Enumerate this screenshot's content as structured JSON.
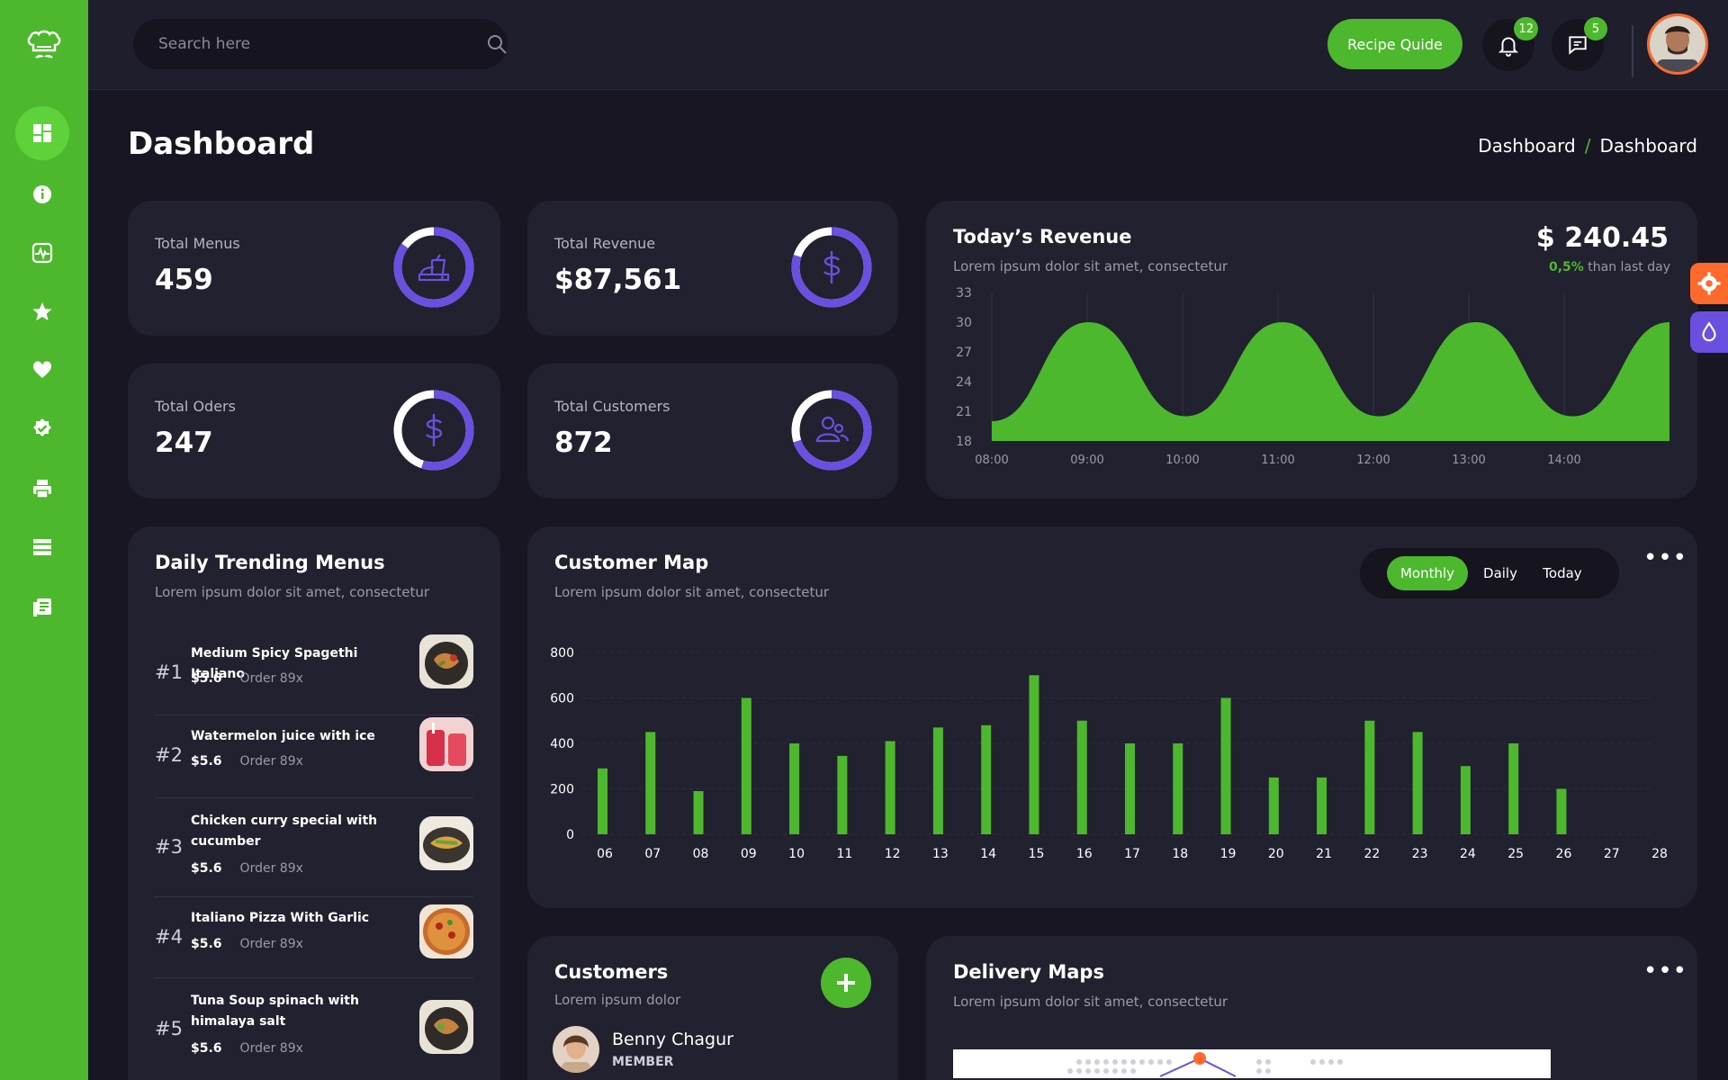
{
  "header": {
    "search_placeholder": "Search here",
    "recipe_button": "Recipe Quide",
    "notifications_count": "12",
    "messages_count": "5"
  },
  "page": {
    "title": "Dashboard",
    "breadcrumb": [
      "Dashboard",
      "/",
      "Dashboard"
    ]
  },
  "stats": [
    {
      "label": "Total Menus",
      "value": "459",
      "icon": "fast-food-icon",
      "progress": 0.85
    },
    {
      "label": "Total Revenue",
      "value": "$87,561",
      "icon": "dollar-icon",
      "progress": 0.8
    },
    {
      "label": "Total Oders",
      "value": "247",
      "icon": "dollar-icon",
      "progress": 0.55
    },
    {
      "label": "Total Customers",
      "value": "872",
      "icon": "customers-icon",
      "progress": 0.7
    }
  ],
  "revenue": {
    "title": "Today’s Revenue",
    "subtitle": "Lorem ipsum dolor sit amet, consectetur",
    "amount": "$ 240.45",
    "change_pct": "0,5%",
    "change_text": "than last day"
  },
  "trending": {
    "title": "Daily Trending Menus",
    "subtitle": "Lorem ipsum dolor sit amet, consectetur",
    "items": [
      {
        "rank": "#1",
        "name": "Medium Spicy Spagethi Italiano",
        "price": "$5.6",
        "order": "Order 89x"
      },
      {
        "rank": "#2",
        "name": "Watermelon juice with ice",
        "price": "$5.6",
        "order": "Order 89x"
      },
      {
        "rank": "#3",
        "name": "Chicken curry special with cucumber",
        "price": "$5.6",
        "order": "Order 89x"
      },
      {
        "rank": "#4",
        "name": "Italiano Pizza With Garlic",
        "price": "$5.6",
        "order": "Order 89x"
      },
      {
        "rank": "#5",
        "name": "Tuna Soup spinach with himalaya salt",
        "price": "$5.6",
        "order": "Order 89x"
      }
    ]
  },
  "customer_map": {
    "title": "Customer Map",
    "subtitle": "Lorem ipsum dolor sit amet, consectetur",
    "tabs": [
      "Monthly",
      "Daily",
      "Today"
    ],
    "active_tab": "Monthly"
  },
  "customers": {
    "title": "Customers",
    "subtitle": "Lorem ipsum dolor",
    "person_name": "Benny Chagur",
    "person_role": "MEMBER"
  },
  "delivery": {
    "title": "Delivery Maps",
    "subtitle": "Lorem ipsum dolor sit amet, consectetur"
  },
  "colors": {
    "accent": "#4db82d",
    "ring": "#6a4fe0",
    "orange": "#ff6a2c",
    "purple": "#6a4fe0"
  },
  "chart_data": [
    {
      "type": "area",
      "x": [
        "08:00",
        "09:00",
        "10:00",
        "11:00",
        "12:00",
        "13:00",
        "14:00"
      ],
      "y_ticks": [
        18,
        21,
        24,
        27,
        30,
        33
      ],
      "ylim": [
        18,
        33
      ],
      "series": [
        {
          "values": [
            20,
            30,
            20.5,
            30,
            20.5,
            30,
            20.5,
            30
          ]
        }
      ],
      "series_x": [
        0,
        1,
        2,
        3,
        4,
        5,
        6,
        7
      ]
    },
    {
      "type": "bar",
      "categories": [
        "06",
        "07",
        "08",
        "09",
        "10",
        "11",
        "12",
        "13",
        "14",
        "15",
        "16",
        "17",
        "18",
        "19",
        "20",
        "21",
        "22",
        "23",
        "24",
        "25",
        "26",
        "27",
        "28"
      ],
      "values": [
        290,
        450,
        190,
        600,
        400,
        345,
        410,
        470,
        480,
        700,
        500,
        400,
        400,
        600,
        250,
        250,
        500,
        450,
        300,
        400,
        200
      ],
      "y_ticks": [
        0,
        200,
        400,
        600,
        800
      ],
      "ylim": [
        0,
        800
      ]
    }
  ]
}
